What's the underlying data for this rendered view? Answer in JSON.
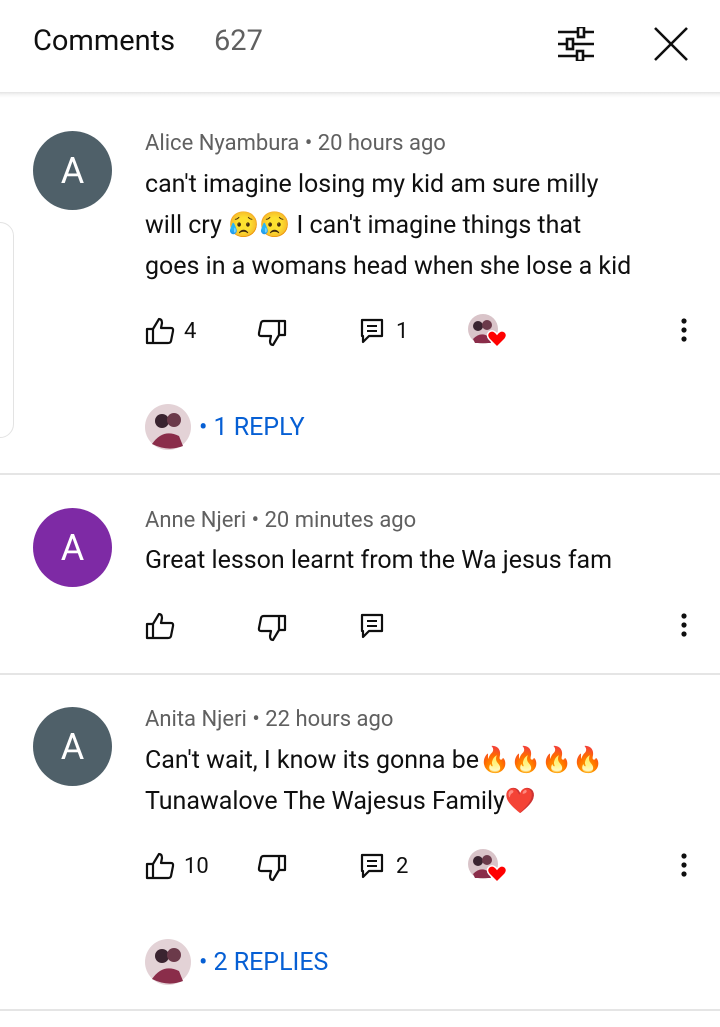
{
  "header": {
    "title": "Comments",
    "count": "627",
    "filter_icon": "sliders-icon",
    "close_icon": "close-icon"
  },
  "colors": {
    "link_blue": "#065fd4",
    "avatar_slate": "#4f6069",
    "avatar_purple": "#7e2aa5",
    "heart_red": "#ff0000"
  },
  "comments": [
    {
      "avatar_letter": "A",
      "author": "Alice Nyambura",
      "time": "20 hours ago",
      "text_lines": [
        "can't imagine losing my kid am sure milly",
        "will cry  😥😥 I can't imagine things that",
        "goes in a womans head when she lose a kid"
      ],
      "likes": "4",
      "replies_count": "1",
      "creator_hearted": true,
      "replies_label": "1 REPLY"
    },
    {
      "avatar_letter": "A",
      "author": "Anne Njeri",
      "time": "20 minutes ago",
      "text_lines": [
        "Great lesson learnt from the Wa jesus fam"
      ],
      "likes": "",
      "replies_count": "",
      "creator_hearted": false,
      "replies_label": ""
    },
    {
      "avatar_letter": "A",
      "author": "Anita Njeri",
      "time": "22 hours ago",
      "text_lines": [
        "Can't wait, I know its gonna be🔥🔥🔥🔥",
        "Tunawalove The Wajesus Family❤️"
      ],
      "likes": "10",
      "replies_count": "2",
      "creator_hearted": true,
      "replies_label": "2 REPLIES"
    }
  ]
}
